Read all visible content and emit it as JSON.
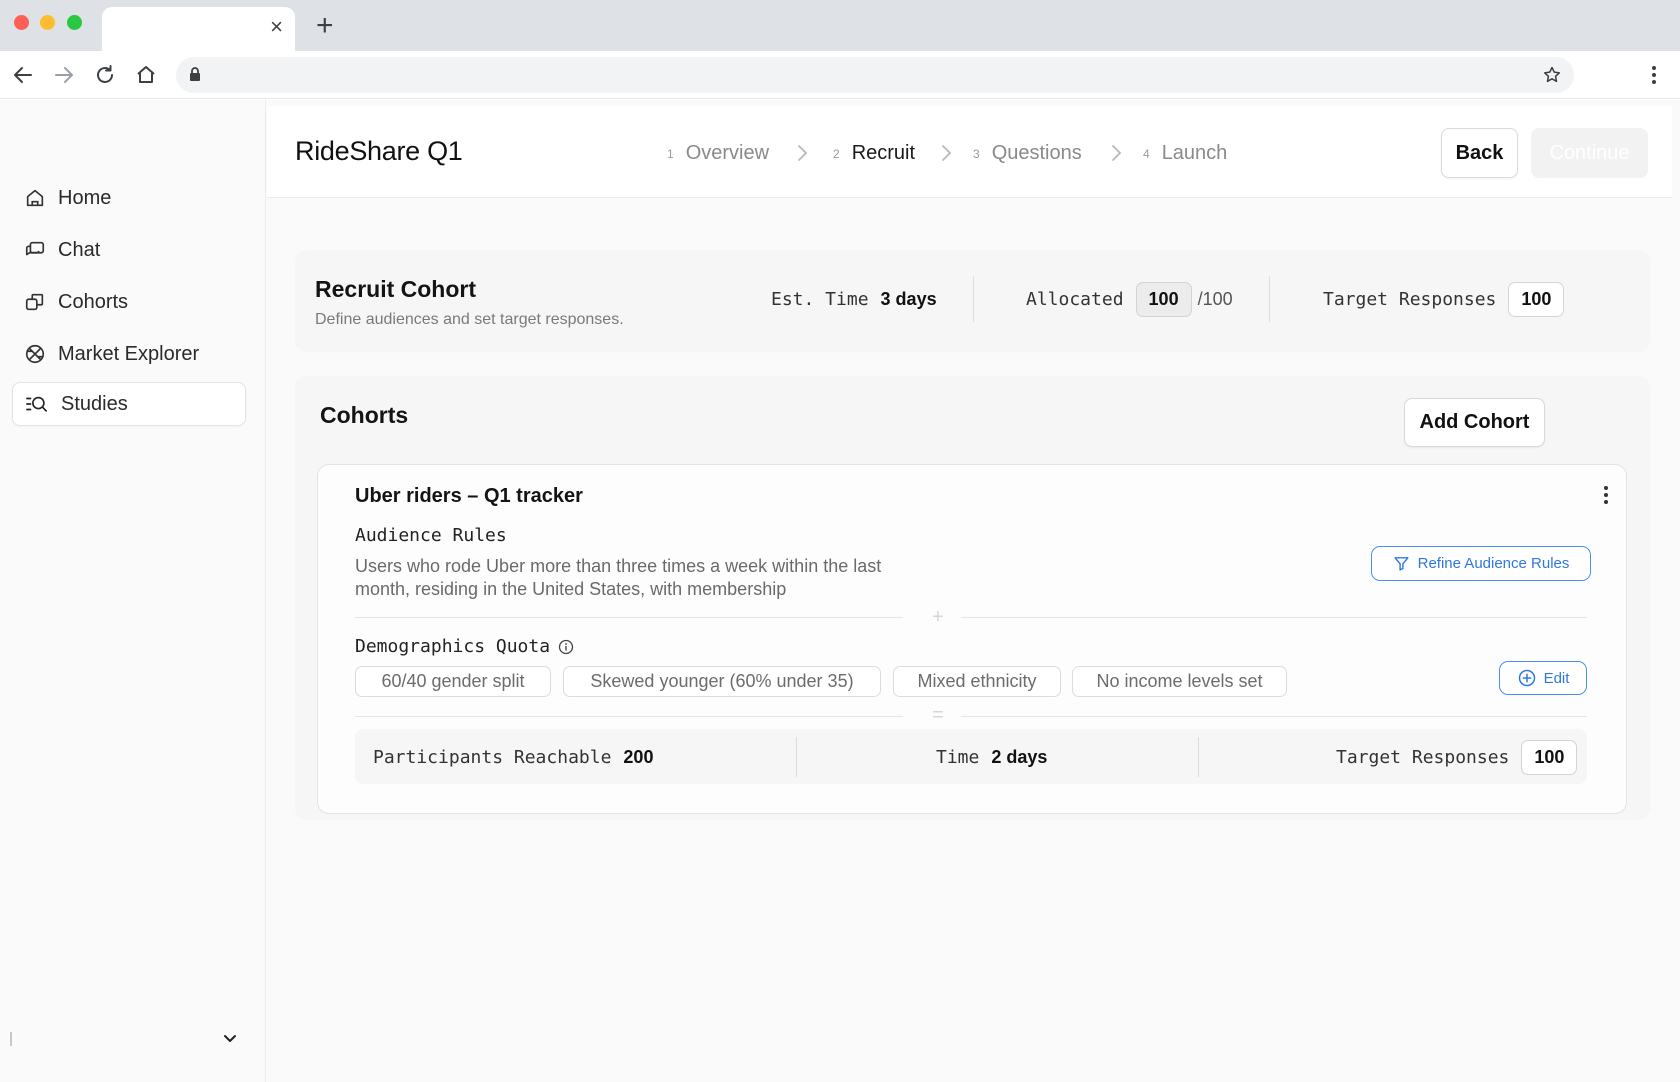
{
  "browser": {
    "tab_close": "×",
    "new_tab": "+"
  },
  "sidebar": {
    "items": [
      {
        "label": "Home",
        "icon": "home-icon",
        "active": false
      },
      {
        "label": "Chat",
        "icon": "chat-icon",
        "active": false
      },
      {
        "label": "Cohorts",
        "icon": "cohorts-icon",
        "active": false
      },
      {
        "label": "Market Explorer",
        "icon": "globe-icon",
        "active": false
      },
      {
        "label": "Studies",
        "icon": "studies-search-icon",
        "active": true
      }
    ]
  },
  "header": {
    "title": "RideShare Q1",
    "steps": [
      {
        "num": "1",
        "label": "Overview",
        "current": false
      },
      {
        "num": "2",
        "label": "Recruit",
        "current": true
      },
      {
        "num": "3",
        "label": "Questions",
        "current": false
      },
      {
        "num": "4",
        "label": "Launch",
        "current": false
      }
    ],
    "back_label": "Back",
    "continue_label": "Continue"
  },
  "recruit": {
    "title": "Recruit Cohort",
    "subtitle": "Define audiences and set target responses.",
    "est_time_label": "Est. Time",
    "est_time_value": "3 days",
    "allocated_label": "Allocated",
    "allocated_value": "100",
    "allocated_total": "/100",
    "target_label": "Target Responses",
    "target_value": "100"
  },
  "cohorts": {
    "title": "Cohorts",
    "add_label": "Add Cohort",
    "card": {
      "name": "Uber riders – Q1 tracker",
      "audience_label": "Audience Rules",
      "audience_text": "Users who rode Uber more than three times a week within the last month, residing in the United States, with membership",
      "refine_label": "Refine Audience Rules",
      "demographics_label": "Demographics Quota",
      "plus_sep": "+",
      "equals_sep": "=",
      "tags": [
        "60/40 gender split",
        "Skewed younger (60% under 35)",
        "Mixed ethnicity",
        "No income levels set"
      ],
      "edit_label": "Edit",
      "reachable_label": "Participants Reachable",
      "reachable_value": "200",
      "time_label": "Time",
      "time_value": "2 days",
      "target_label": "Target Responses",
      "target_value": "100"
    }
  },
  "colors": {
    "accent_blue": "#2f78e0",
    "background": "#fafafa"
  }
}
